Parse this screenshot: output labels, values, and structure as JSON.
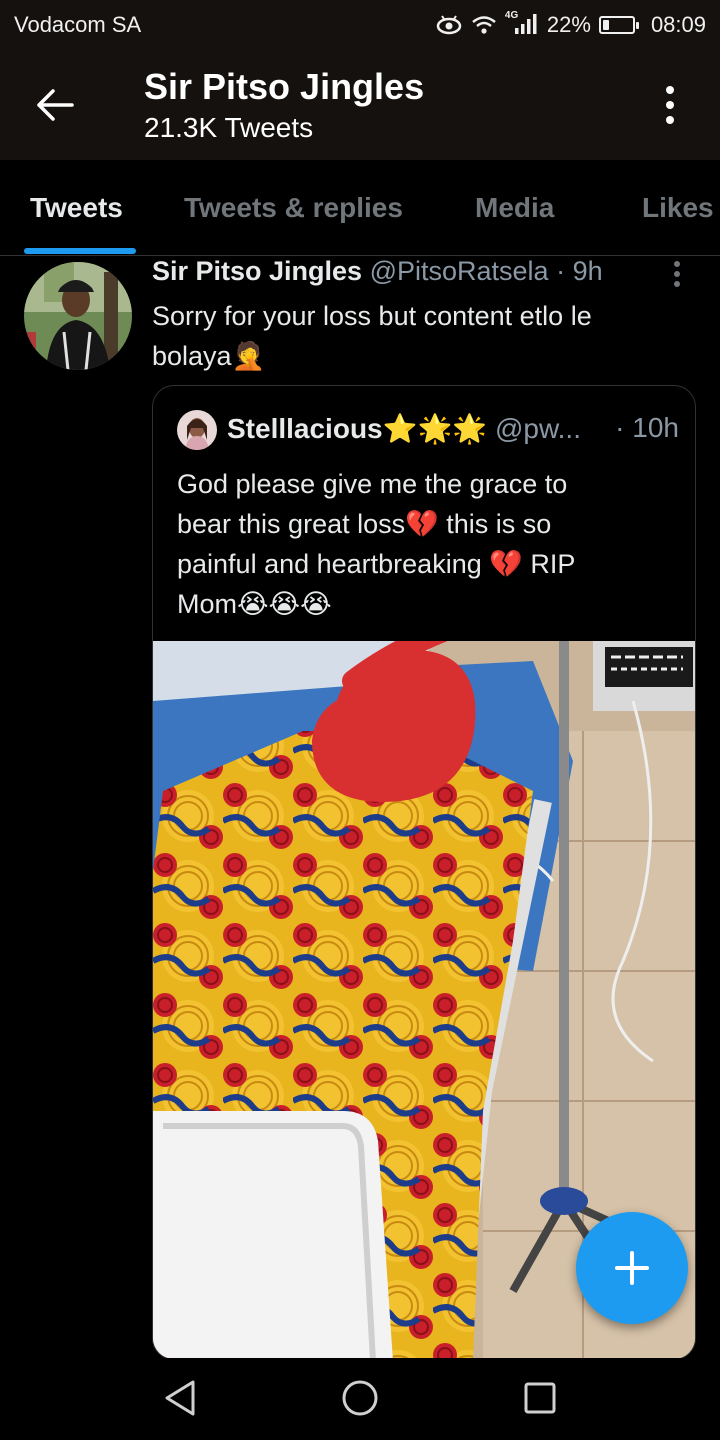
{
  "status_bar": {
    "carrier": "Vodacom SA",
    "network": "4G",
    "battery": "22%",
    "battery_level": 0.22,
    "time": "08:09",
    "icons": [
      "eye-comfort-icon",
      "wifi-icon",
      "signal-icon",
      "battery-icon"
    ]
  },
  "header": {
    "title": "Sir Pitso Jingles",
    "subtitle": "21.3K Tweets",
    "back_icon": "arrow-left-icon",
    "more_icon": "vertical-dots-icon"
  },
  "tabs": [
    {
      "label": "Tweets",
      "active": true
    },
    {
      "label": "Tweets & replies",
      "active": false
    },
    {
      "label": "Media",
      "active": false
    },
    {
      "label": "Likes",
      "active": false
    }
  ],
  "tweet": {
    "author_name": "Sir Pitso Jingles",
    "handle_time": "@PitsoRatsela · 9h",
    "text_line1": "Sorry for your loss but content etlo le",
    "text_line2": "bolaya🤦",
    "quote": {
      "author_name": "Stelllacious⭐🌟🌟",
      "handle": "@pw...",
      "time": "· 10h",
      "lines": [
        "God please give me the grace to",
        "bear this great loss💔 this is so",
        "painful and heartbreaking 💔 RIP",
        "Mom😭😭😭"
      ]
    }
  },
  "fab": {
    "icon": "plus-icon"
  },
  "nav": {
    "icons": [
      "back-triangle-icon",
      "home-circle-icon",
      "recents-square-icon"
    ]
  },
  "colors": {
    "accent": "#1d9bf0",
    "header_bg": "#15110e",
    "background": "#000000",
    "muted_text": "#8b98a5"
  }
}
